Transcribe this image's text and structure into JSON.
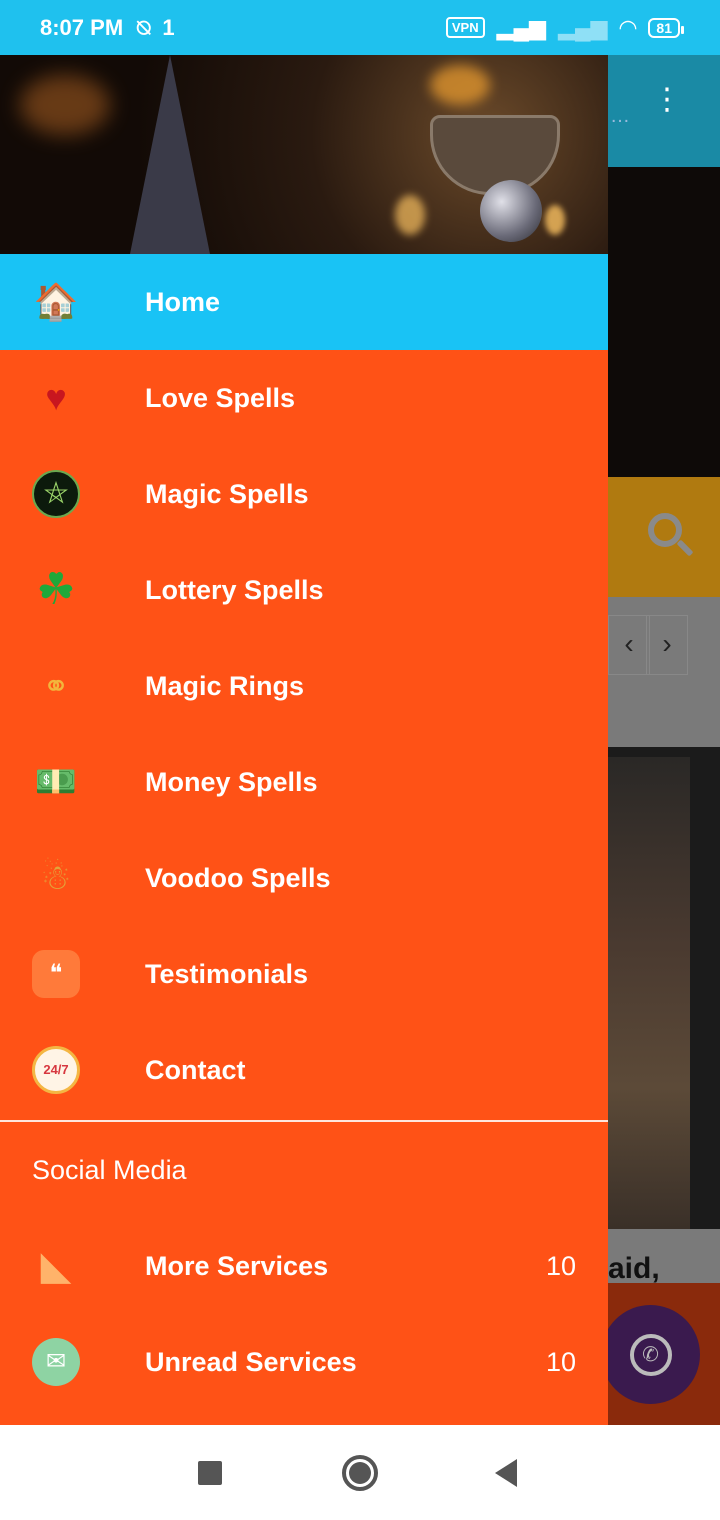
{
  "status_bar": {
    "time": "8:07 PM",
    "vpn": "VPN",
    "battery": "81"
  },
  "background_app": {
    "partial_text": "aid,",
    "pager_prev": "‹",
    "pager_next": "›"
  },
  "drawer": {
    "menu": [
      {
        "label": "Home",
        "icon": "home-icon",
        "active": true
      },
      {
        "label": "Love Spells",
        "icon": "heart-icon"
      },
      {
        "label": "Magic Spells",
        "icon": "pentagram-icon"
      },
      {
        "label": "Lottery Spells",
        "icon": "clover-icon"
      },
      {
        "label": "Magic Rings",
        "icon": "rings-icon"
      },
      {
        "label": "Money Spells",
        "icon": "money-icon"
      },
      {
        "label": "Voodoo Spells",
        "icon": "voodoo-doll-icon"
      },
      {
        "label": "Testimonials",
        "icon": "chat-bubble-icon"
      },
      {
        "label": "Contact",
        "icon": "phone-24-7-icon"
      }
    ],
    "section_title": "Social Media",
    "social": [
      {
        "label": "More Services",
        "count": "10",
        "icon": "rss-icon"
      },
      {
        "label": "Unread Services",
        "count": "10",
        "icon": "mail-icon"
      }
    ]
  },
  "colors": {
    "drawer_bg": "#ff5216",
    "active_bg": "#19c3f5",
    "status_bar": "#1fc1ee"
  }
}
